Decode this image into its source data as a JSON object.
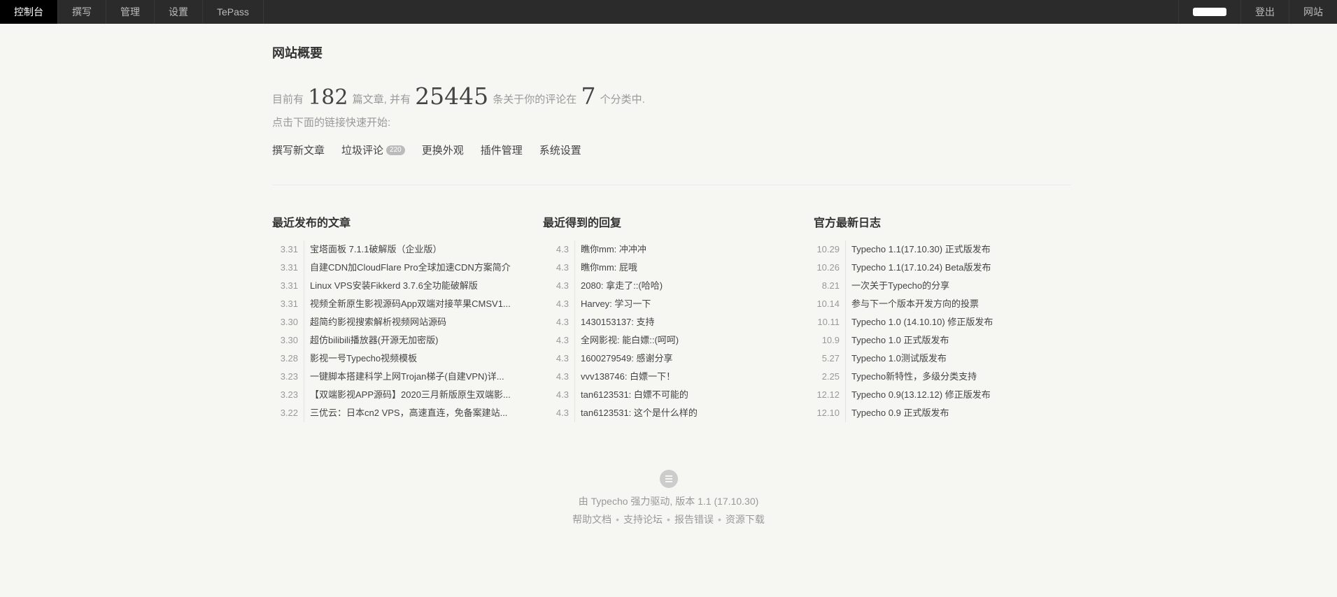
{
  "nav": {
    "left": [
      {
        "label": "控制台",
        "active": true
      },
      {
        "label": "撰写",
        "active": false
      },
      {
        "label": "管理",
        "active": false
      },
      {
        "label": "设置",
        "active": false
      },
      {
        "label": "TePass",
        "active": false
      }
    ],
    "right": {
      "logout": "登出",
      "site": "网站"
    }
  },
  "overview": {
    "title": "网站概要",
    "summary_prefix": "目前有",
    "post_count": "182",
    "summary_mid1": "篇文章, 并有",
    "comment_count": "25445",
    "summary_mid2": "条关于你的评论在",
    "category_count": "7",
    "summary_suffix": "个分类中.",
    "hint": "点击下面的链接快速开始:",
    "quick_links": {
      "write": "撰写新文章",
      "spam": "垃圾评论",
      "spam_count": "220",
      "theme": "更换外观",
      "plugins": "插件管理",
      "settings": "系统设置"
    }
  },
  "recent_posts": {
    "title": "最近发布的文章",
    "items": [
      {
        "date": "3.31",
        "text": "宝塔面板 7.1.1破解版（企业版）"
      },
      {
        "date": "3.31",
        "text": "自建CDN加CloudFlare Pro全球加速CDN方案简介"
      },
      {
        "date": "3.31",
        "text": "Linux VPS安装Fikkerd 3.7.6全功能破解版"
      },
      {
        "date": "3.31",
        "text": "视频全新原生影视源码App双端对接苹果CMSV1..."
      },
      {
        "date": "3.30",
        "text": "超简约影视搜索解析视频网站源码"
      },
      {
        "date": "3.30",
        "text": "超仿bilibili播放器(开源无加密版)"
      },
      {
        "date": "3.28",
        "text": "影视一号Typecho视频模板"
      },
      {
        "date": "3.23",
        "text": "一键脚本搭建科学上网Trojan梯子(自建VPN)详..."
      },
      {
        "date": "3.23",
        "text": "【双端影视APP源码】2020三月新版原生双端影..."
      },
      {
        "date": "3.22",
        "text": "三优云：日本cn2 VPS，高速直连，免备案建站..."
      }
    ]
  },
  "recent_replies": {
    "title": "最近得到的回复",
    "items": [
      {
        "date": "4.3",
        "text": "瞧你mm: 冲冲冲"
      },
      {
        "date": "4.3",
        "text": "瞧你mm: 屁哦"
      },
      {
        "date": "4.3",
        "text": "2080: 拿走了::(哈哈)"
      },
      {
        "date": "4.3",
        "text": "Harvey: 学习一下"
      },
      {
        "date": "4.3",
        "text": "1430153137: 支持"
      },
      {
        "date": "4.3",
        "text": "全网影视: 能白嫖::(呵呵)"
      },
      {
        "date": "4.3",
        "text": "1600279549: 感谢分享"
      },
      {
        "date": "4.3",
        "text": "vvv138746: 白嫖一下！"
      },
      {
        "date": "4.3",
        "text": "tan6123531: 白嫖不可能的"
      },
      {
        "date": "4.3",
        "text": "tan6123531: 这个是什么样的"
      }
    ]
  },
  "official_log": {
    "title": "官方最新日志",
    "items": [
      {
        "date": "10.29",
        "text": "Typecho 1.1(17.10.30) 正式版发布"
      },
      {
        "date": "10.26",
        "text": "Typecho 1.1(17.10.24) Beta版发布"
      },
      {
        "date": "8.21",
        "text": "一次关于Typecho的分享"
      },
      {
        "date": "10.14",
        "text": "参与下一个版本开发方向的投票"
      },
      {
        "date": "10.11",
        "text": "Typecho 1.0 (14.10.10) 修正版发布"
      },
      {
        "date": "10.9",
        "text": "Typecho 1.0 正式版发布"
      },
      {
        "date": "5.27",
        "text": "Typecho 1.0测试版发布"
      },
      {
        "date": "2.25",
        "text": "Typecho新特性，多级分类支持"
      },
      {
        "date": "12.12",
        "text": "Typecho 0.9(13.12.12) 修正版发布"
      },
      {
        "date": "12.10",
        "text": "Typecho 0.9 正式版发布"
      }
    ]
  },
  "footer": {
    "powered": "由 Typecho 强力驱动, 版本 1.1 (17.10.30)",
    "links": [
      "帮助文档",
      "支持论坛",
      "报告错误",
      "资源下载"
    ],
    "separator": "•"
  },
  "icons": {
    "footer_logo": "typecho-logo-icon"
  }
}
